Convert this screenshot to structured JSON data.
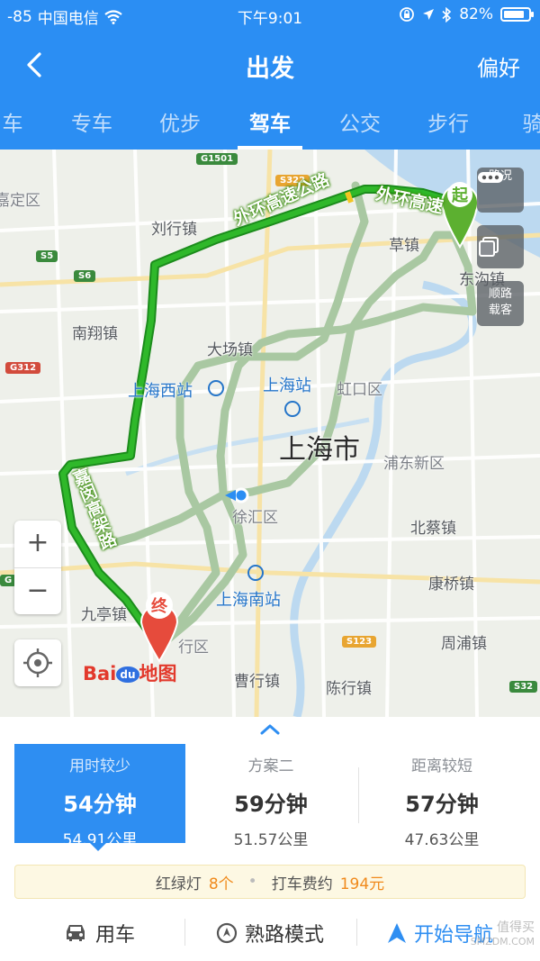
{
  "status_bar": {
    "signal": "-85",
    "carrier": "中国电信",
    "time": "下午9:01",
    "battery": "82%"
  },
  "nav": {
    "title": "出发",
    "preference": "偏好"
  },
  "modes": [
    {
      "label": "车",
      "active": false
    },
    {
      "label": "专车",
      "active": false
    },
    {
      "label": "优步",
      "active": false
    },
    {
      "label": "驾车",
      "active": true
    },
    {
      "label": "公交",
      "active": false
    },
    {
      "label": "步行",
      "active": false
    },
    {
      "label": "骑",
      "active": false
    }
  ],
  "map": {
    "city": "上海市",
    "districts": [
      "嘉定区",
      "刘行镇",
      "草镇",
      "东沟镇",
      "南翔镇",
      "大场镇",
      "虹口区",
      "浦东新区",
      "徐汇区",
      "北蔡镇",
      "康桥镇",
      "九亭镇",
      "周浦镇",
      "曹行镇",
      "陈行镇",
      "行区"
    ],
    "stations": [
      "上海西站",
      "上海站",
      "上海南站"
    ],
    "highway_labels": [
      "外环高速公路",
      "外环高速",
      "嘉闵高架路"
    ],
    "road_shields": [
      "G1501",
      "S322",
      "S5",
      "S6",
      "G312",
      "S123",
      "S32",
      "G"
    ],
    "start_marker": "起",
    "end_marker": "终",
    "traffic_button": "路况",
    "carpool_button": {
      "line1": "顺路",
      "line2": "载客"
    },
    "zoom_in": "+",
    "zoom_out": "−",
    "logo": {
      "bai": "Bai",
      "du": "du",
      "ditu": "地图"
    },
    "colors": {
      "route_primary": "#2fb82a",
      "route_alt": "#a9c8a2",
      "water": "#bcd9f0",
      "accent": "#2b8ef3"
    }
  },
  "plans": [
    {
      "name": "用时较少",
      "time": "54分钟",
      "distance": "54.91公里",
      "selected": true
    },
    {
      "name": "方案二",
      "time": "59分钟",
      "distance": "51.57公里",
      "selected": false
    },
    {
      "name": "距离较短",
      "time": "57分钟",
      "distance": "47.63公里",
      "selected": false
    }
  ],
  "info": {
    "lights_label": "红绿灯",
    "lights_value": "8个",
    "fare_label": "打车费约",
    "fare_value": "194元"
  },
  "actions": {
    "car": "用车",
    "familiar": "熟路模式",
    "navigate": "开始导航"
  },
  "watermark": {
    "line1": "值得买",
    "line2": "SMZDM.COM"
  }
}
